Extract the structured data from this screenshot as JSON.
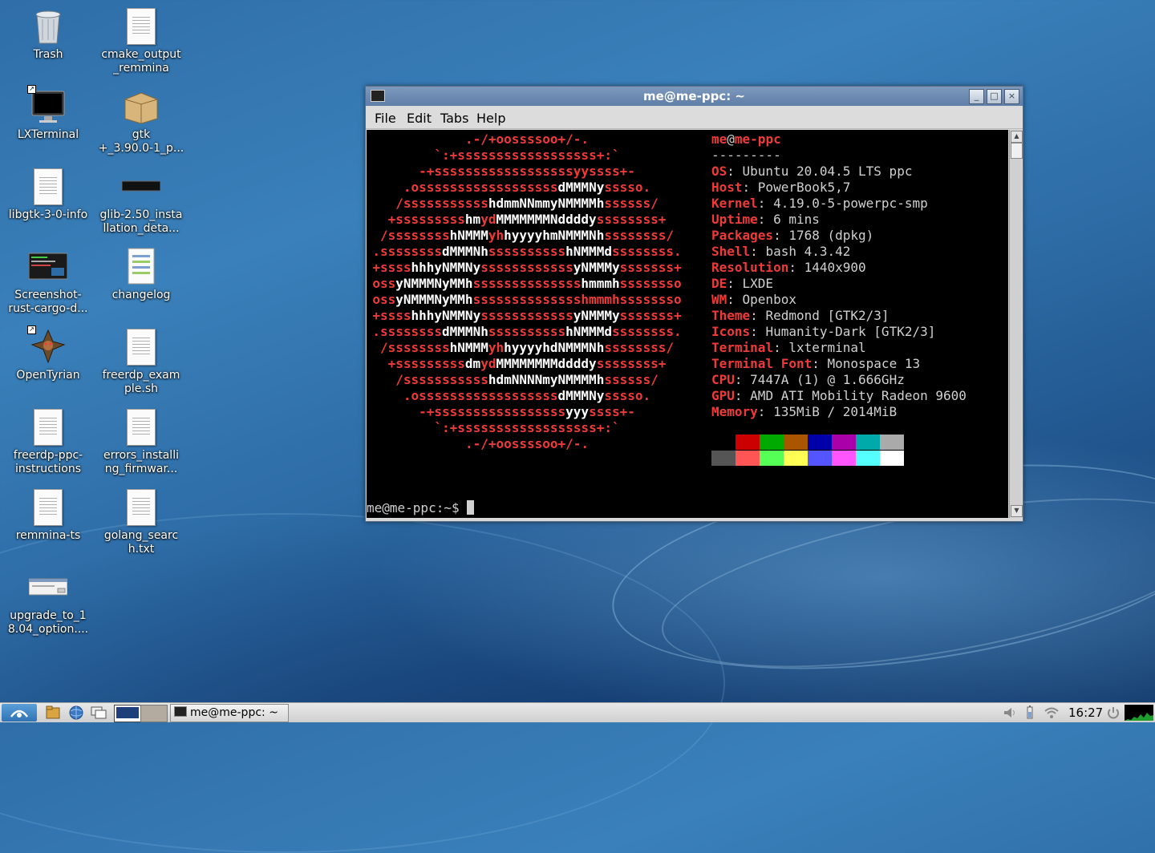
{
  "desktop": {
    "icons": [
      {
        "label": "Trash"
      },
      {
        "label": "cmake_output\n_remmina"
      },
      {
        "label": "LXTerminal"
      },
      {
        "label": "gtk\n+_3.90.0-1_p..."
      },
      {
        "label": "libgtk-3-0-info"
      },
      {
        "label": "glib-2.50_insta\nllation_deta..."
      },
      {
        "label": "Screenshot-\nrust-cargo-d..."
      },
      {
        "label": "changelog"
      },
      {
        "label": "OpenTyrian"
      },
      {
        "label": "freerdp_exam\nple.sh"
      },
      {
        "label": "freerdp-ppc-\ninstructions"
      },
      {
        "label": "errors_installi\nng_firmwar..."
      },
      {
        "label": "remmina-ts"
      },
      {
        "label": "golang_searc\nh.txt"
      },
      {
        "label": "upgrade_to_1\n8.04_option...."
      }
    ]
  },
  "window": {
    "title": "me@me-ppc: ~",
    "controls": {
      "minimize": "_",
      "maximize": "□",
      "close": "×"
    }
  },
  "menu": {
    "file": "File",
    "edit": "Edit",
    "tabs": "Tabs",
    "help": "Help"
  },
  "terminal": {
    "logo": [
      [
        [
          ".-/+oossssoo+/-.",
          0
        ]
      ],
      [
        [
          "`:+ssssssssssssssssss+:`",
          0
        ]
      ],
      [
        [
          "-+ssssssssssssssssssyyssss+-",
          0
        ]
      ],
      [
        [
          ".ossssssssssssssssss",
          0
        ],
        [
          "dMMMNy",
          1
        ],
        [
          "sssso.",
          0
        ]
      ],
      [
        [
          "/sssssssssss",
          0
        ],
        [
          "hdmmNNmmyNMMMMh",
          1
        ],
        [
          "ssssss/",
          0
        ]
      ],
      [
        [
          "+sssssssss",
          0
        ],
        [
          "hm",
          1
        ],
        [
          "yd",
          0
        ],
        [
          "MMMMMMMNddddy",
          1
        ],
        [
          "ssssssss+",
          0
        ]
      ],
      [
        [
          "/ssssssss",
          0
        ],
        [
          "hNMMM",
          1
        ],
        [
          "yh",
          0
        ],
        [
          "hyyyyhmNMMMNh",
          1
        ],
        [
          "ssssssss/",
          0
        ]
      ],
      [
        [
          ".ssssssss",
          0
        ],
        [
          "dMMMNh",
          1
        ],
        [
          "ssssssssss",
          0
        ],
        [
          "hNMMMd",
          1
        ],
        [
          "ssssssss.",
          0
        ]
      ],
      [
        [
          "+ssss",
          0
        ],
        [
          "hhhyNMMNy",
          1
        ],
        [
          "ssssssssssss",
          0
        ],
        [
          "yNMMMy",
          1
        ],
        [
          "sssssss+",
          0
        ]
      ],
      [
        [
          "oss",
          0
        ],
        [
          "yNMMMNyMMh",
          1
        ],
        [
          "ssssssssssssss",
          0
        ],
        [
          "hmmmh",
          1
        ],
        [
          "ssssssso",
          0
        ]
      ],
      [
        [
          "oss",
          0
        ],
        [
          "yNMMMNyMMh",
          1
        ],
        [
          "sssssssssssssshmmmhssssssso",
          0
        ]
      ],
      [
        [
          "+ssss",
          0
        ],
        [
          "hhhyNMMNy",
          1
        ],
        [
          "ssssssssssss",
          0
        ],
        [
          "yNMMMy",
          1
        ],
        [
          "sssssss+",
          0
        ]
      ],
      [
        [
          ".ssssssss",
          0
        ],
        [
          "dMMMNh",
          1
        ],
        [
          "ssssssssss",
          0
        ],
        [
          "hNMMMd",
          1
        ],
        [
          "ssssssss.",
          0
        ]
      ],
      [
        [
          "/ssssssss",
          0
        ],
        [
          "hNMMM",
          1
        ],
        [
          "yh",
          0
        ],
        [
          "hyyyyhdNMMMNh",
          1
        ],
        [
          "ssssssss/",
          0
        ]
      ],
      [
        [
          "+sssssssss",
          0
        ],
        [
          "dm",
          1
        ],
        [
          "yd",
          0
        ],
        [
          "MMMMMMMMddddy",
          1
        ],
        [
          "ssssssss+",
          0
        ]
      ],
      [
        [
          "/sssssssssss",
          0
        ],
        [
          "hdmNNNNmyNMMMMh",
          1
        ],
        [
          "ssssss/",
          0
        ]
      ],
      [
        [
          ".ossssssssssssssssss",
          0
        ],
        [
          "dMMMNy",
          1
        ],
        [
          "sssso.",
          0
        ]
      ],
      [
        [
          "-+sssssssssssssssss",
          0
        ],
        [
          "yyy",
          1
        ],
        [
          "ssss+-",
          0
        ]
      ],
      [
        [
          "`:+ssssssssssssssssss+:`",
          0
        ]
      ],
      [
        [
          ".-/+oossssoo+/-.",
          0
        ]
      ]
    ],
    "header_user": "me",
    "header_at": "@",
    "header_host": "me-ppc",
    "separator": "---------",
    "info": [
      {
        "key": "OS",
        "value": ": Ubuntu 20.04.5 LTS ppc"
      },
      {
        "key": "Host",
        "value": ": PowerBook5,7"
      },
      {
        "key": "Kernel",
        "value": ": 4.19.0-5-powerpc-smp"
      },
      {
        "key": "Uptime",
        "value": ": 6 mins"
      },
      {
        "key": "Packages",
        "value": ": 1768 (dpkg)"
      },
      {
        "key": "Shell",
        "value": ": bash 4.3.42"
      },
      {
        "key": "Resolution",
        "value": ": 1440x900"
      },
      {
        "key": "DE",
        "value": ": LXDE"
      },
      {
        "key": "WM",
        "value": ": Openbox"
      },
      {
        "key": "Theme",
        "value": ": Redmond [GTK2/3]"
      },
      {
        "key": "Icons",
        "value": ": Humanity-Dark [GTK2/3]"
      },
      {
        "key": "Terminal",
        "value": ": lxterminal"
      },
      {
        "key": "Terminal Font",
        "value": ": Monospace 13"
      },
      {
        "key": "CPU",
        "value": ": 7447A (1) @ 1.666GHz"
      },
      {
        "key": "GPU",
        "value": ": AMD ATI Mobility Radeon 9600"
      },
      {
        "key": "Memory",
        "value": ": 135MiB / 2014MiB"
      }
    ],
    "palette_dark": [
      "#000000",
      "#cc0000",
      "#00aa00",
      "#aa5500",
      "#0000aa",
      "#aa00aa",
      "#00aaaa",
      "#aaaaaa"
    ],
    "palette_bright": [
      "#555555",
      "#ff5555",
      "#55ff55",
      "#ffff55",
      "#5555ff",
      "#ff55ff",
      "#55ffff",
      "#ffffff"
    ],
    "prompt": "me@me-ppc:~$ "
  },
  "taskbar": {
    "task_label": "me@me-ppc: ~",
    "clock": "16:27"
  }
}
